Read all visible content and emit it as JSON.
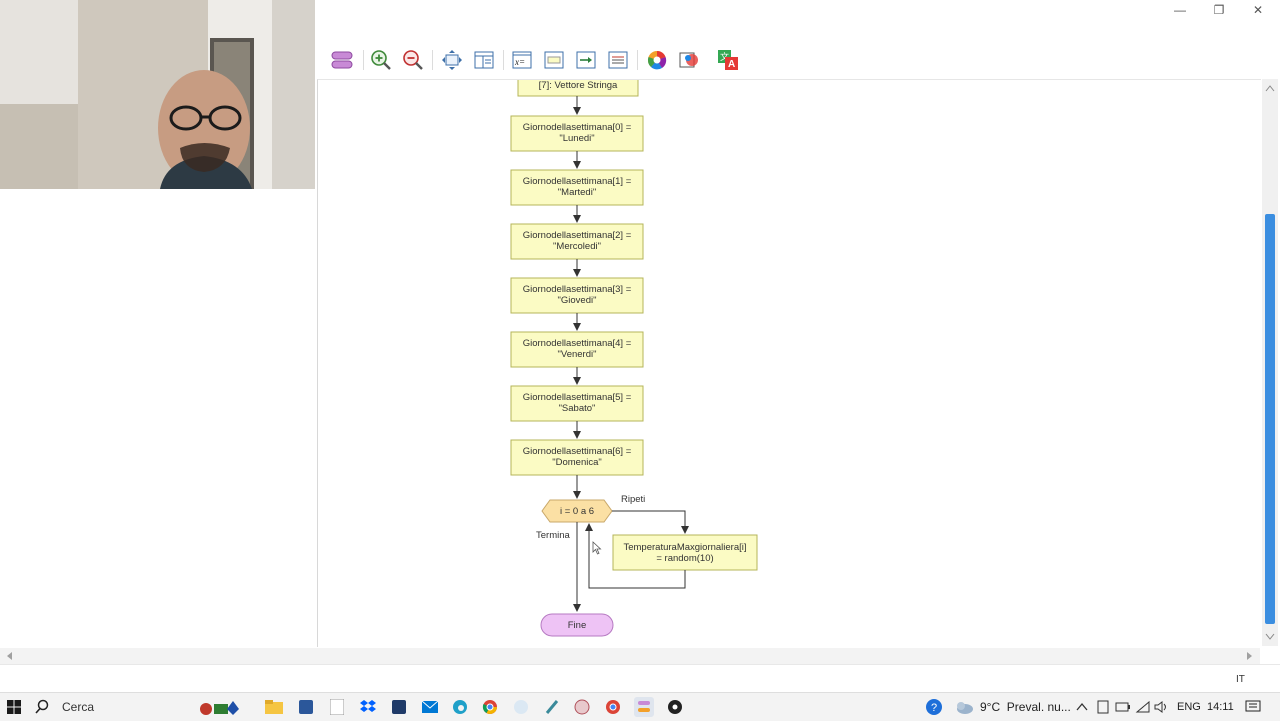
{
  "window": {
    "minimize_icon": "minimize-icon",
    "restore_icon": "restore-icon",
    "close_icon": "close-icon"
  },
  "toolbar": {
    "icons": [
      "loop-shape-icon",
      "zoom-in-icon",
      "zoom-out-icon",
      "fit-vertical-icon",
      "layout-icon",
      "assignment-icon",
      "declare-icon",
      "output-icon",
      "comment-icon",
      "color-wheel-icon",
      "theme-icon",
      "translate-icon"
    ]
  },
  "flowchart": {
    "declare_node": "[7]: Vettore Stringa",
    "assignments": [
      {
        "line1": "Giornodellasettimana[0] =",
        "line2": "\"Lunedi\""
      },
      {
        "line1": "Giornodellasettimana[1] =",
        "line2": "\"Martedi\""
      },
      {
        "line1": "Giornodellasettimana[2] =",
        "line2": "\"Mercoledi\""
      },
      {
        "line1": "Giornodellasettimana[3] =",
        "line2": "\"Giovedi\""
      },
      {
        "line1": "Giornodellasettimana[4] =",
        "line2": "\"Venerdi\""
      },
      {
        "line1": "Giornodellasettimana[5] =",
        "line2": "\"Sabato\""
      },
      {
        "line1": "Giornodellasettimana[6] =",
        "line2": "\"Domenica\""
      }
    ],
    "loop": {
      "label": "i = 0 a 6",
      "repeat_label": "Ripeti",
      "exit_label": "Termina",
      "body_line1": "TemperaturaMaxgiornaliera[i]",
      "body_line2": "= random(10)"
    },
    "end_label": "Fine",
    "colors": {
      "assign_fill": "#fbfbc4",
      "assign_stroke": "#b4b45a",
      "loop_fill": "#fbe0a4",
      "end_fill": "#eec3f5",
      "end_stroke": "#b67ac2",
      "line": "#333333"
    }
  },
  "statusbar": {
    "language": "IT"
  },
  "taskbar": {
    "search_placeholder": "Cerca",
    "weather": "9°C  Preval. nu...",
    "keyboard_lang": "ENG",
    "clock": "14:11"
  }
}
